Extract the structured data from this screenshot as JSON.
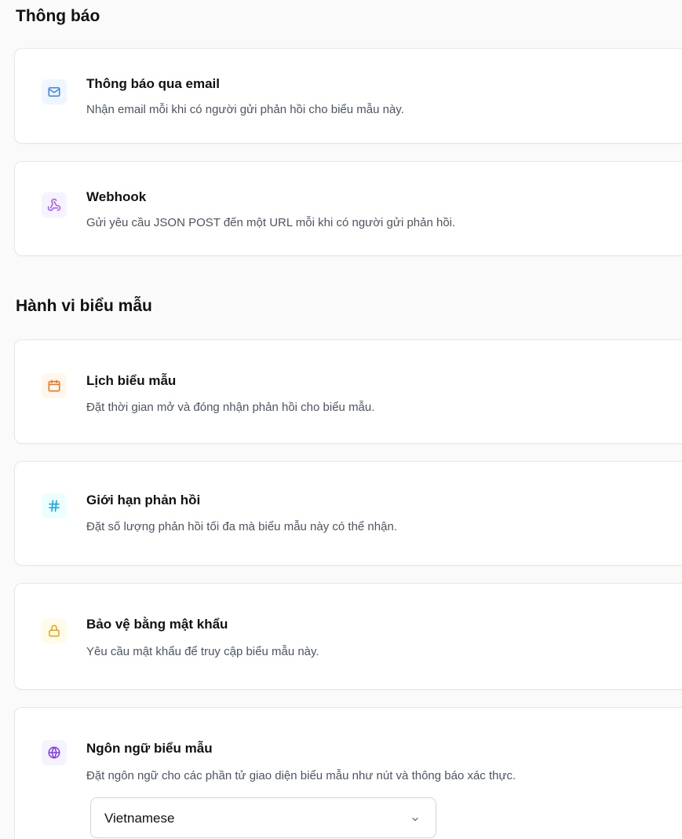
{
  "notifications": {
    "title": "Thông báo",
    "email": {
      "title": "Thông báo qua email",
      "description": "Nhận email mỗi khi có người gửi phản hồi cho biểu mẫu này.",
      "icon": "mail-icon",
      "icon_color": "#3b82f6",
      "icon_bg": "#eff6ff"
    },
    "webhook": {
      "title": "Webhook",
      "description": "Gửi yêu cầu JSON POST đến một URL mỗi khi có người gửi phản hồi.",
      "icon": "webhook-icon",
      "icon_color": "#a855f7",
      "icon_bg": "#f5f3ff"
    }
  },
  "form_behavior": {
    "title": "Hành vi biểu mẫu",
    "schedule": {
      "title": "Lịch biểu mẫu",
      "description": "Đặt thời gian mở và đóng nhận phản hồi cho biểu mẫu.",
      "icon": "calendar-icon",
      "icon_color": "#f97316",
      "icon_bg": "#fff7ed"
    },
    "response_limit": {
      "title": "Giới hạn phản hồi",
      "description": "Đặt số lượng phản hồi tối đa mà biểu mẫu này có thể nhận.",
      "icon": "hash-icon",
      "icon_color": "#0ea5e9",
      "icon_bg": "#ecfeff"
    },
    "password": {
      "title": "Bảo vệ bằng mật khẩu",
      "description": "Yêu cầu mật khẩu để truy cập biểu mẫu này.",
      "icon": "lock-icon",
      "icon_color": "#f59e0b",
      "icon_bg": "#fffbeb"
    },
    "language": {
      "title": "Ngôn ngữ biểu mẫu",
      "description": "Đặt ngôn ngữ cho các phần tử giao diện biểu mẫu như nút và thông báo xác thực.",
      "icon": "globe-icon",
      "icon_color": "#7c3aed",
      "icon_bg": "#f5f3ff",
      "selected": "Vietnamese"
    }
  }
}
